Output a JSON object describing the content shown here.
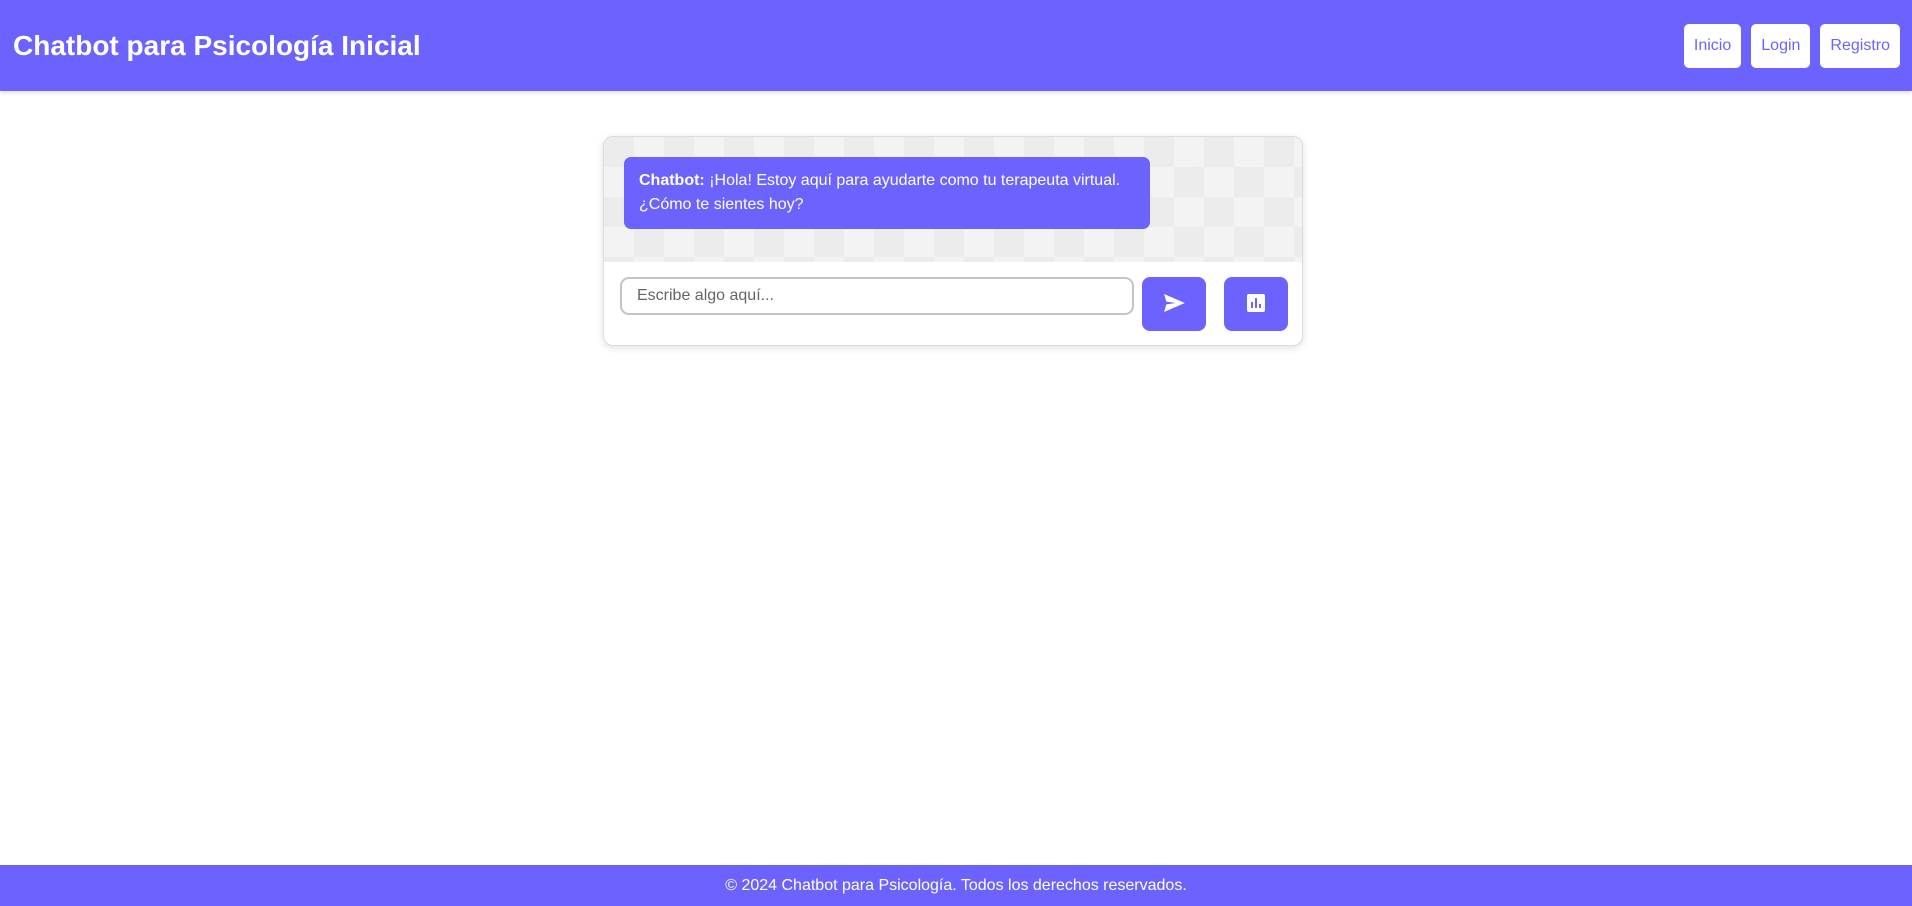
{
  "header": {
    "title": "Chatbot para Psicología Inicial",
    "nav": [
      {
        "label": "Inicio"
      },
      {
        "label": "Login"
      },
      {
        "label": "Registro"
      }
    ]
  },
  "chat": {
    "messages": [
      {
        "sender": "Chatbot:",
        "text": " ¡Hola! Estoy aquí para ayudarte como tu terapeuta virtual. ¿Cómo te sientes hoy?"
      }
    ],
    "input": {
      "placeholder": "Escribe algo aquí...",
      "value": ""
    },
    "send_icon": "send-icon",
    "stats_icon": "bar-chart-icon"
  },
  "footer": {
    "text": "© 2024 Chatbot para Psicología. Todos los derechos reservados."
  },
  "colors": {
    "accent": "#6c63ff",
    "messages_bg": "#ececec"
  }
}
